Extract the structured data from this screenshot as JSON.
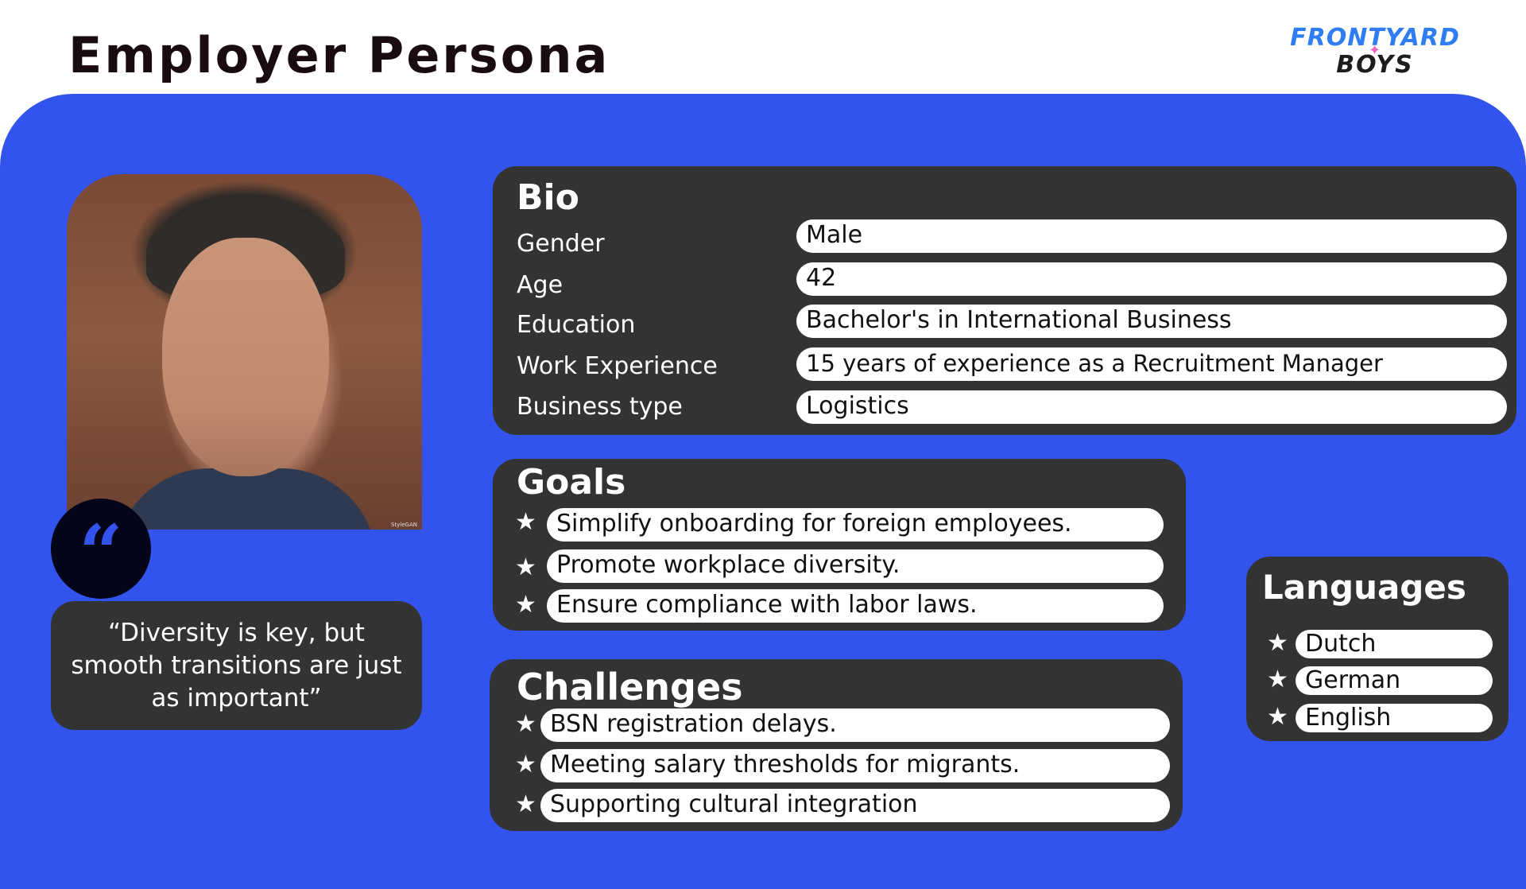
{
  "header": {
    "title": "Employer Persona",
    "logo_top": "FRONTYARD",
    "logo_bottom": "BOYS"
  },
  "colors": {
    "panel_blue": "#3254ed",
    "card_dark": "#333333",
    "logo_blue": "#2e7df2",
    "logo_pink": "#f062c0"
  },
  "photo": {
    "credit": "StyleGAN"
  },
  "quote": {
    "mark": "“",
    "text": "“Diversity is key, but smooth transitions are just as important”"
  },
  "bio": {
    "title": "Bio",
    "rows": [
      {
        "label": "Gender",
        "value": "Male"
      },
      {
        "label": "Age",
        "value": "42"
      },
      {
        "label": "Education",
        "value": "Bachelor's in International Business"
      },
      {
        "label": "Work Experience",
        "value": "15 years of experience as a Recruitment Manager"
      },
      {
        "label": "Business type",
        "value": "Logistics"
      }
    ]
  },
  "goals": {
    "title": "Goals",
    "star": "★",
    "items": [
      "Simplify onboarding for foreign employees.",
      "Promote workplace diversity.",
      "Ensure compliance with labor laws."
    ]
  },
  "challenges": {
    "title": "Challenges",
    "star": "★",
    "items": [
      "BSN registration delays.",
      "Meeting salary thresholds for migrants.",
      "Supporting cultural integration"
    ]
  },
  "languages": {
    "title": "Languages",
    "star": "★",
    "items": [
      "Dutch",
      "German",
      "English"
    ]
  }
}
